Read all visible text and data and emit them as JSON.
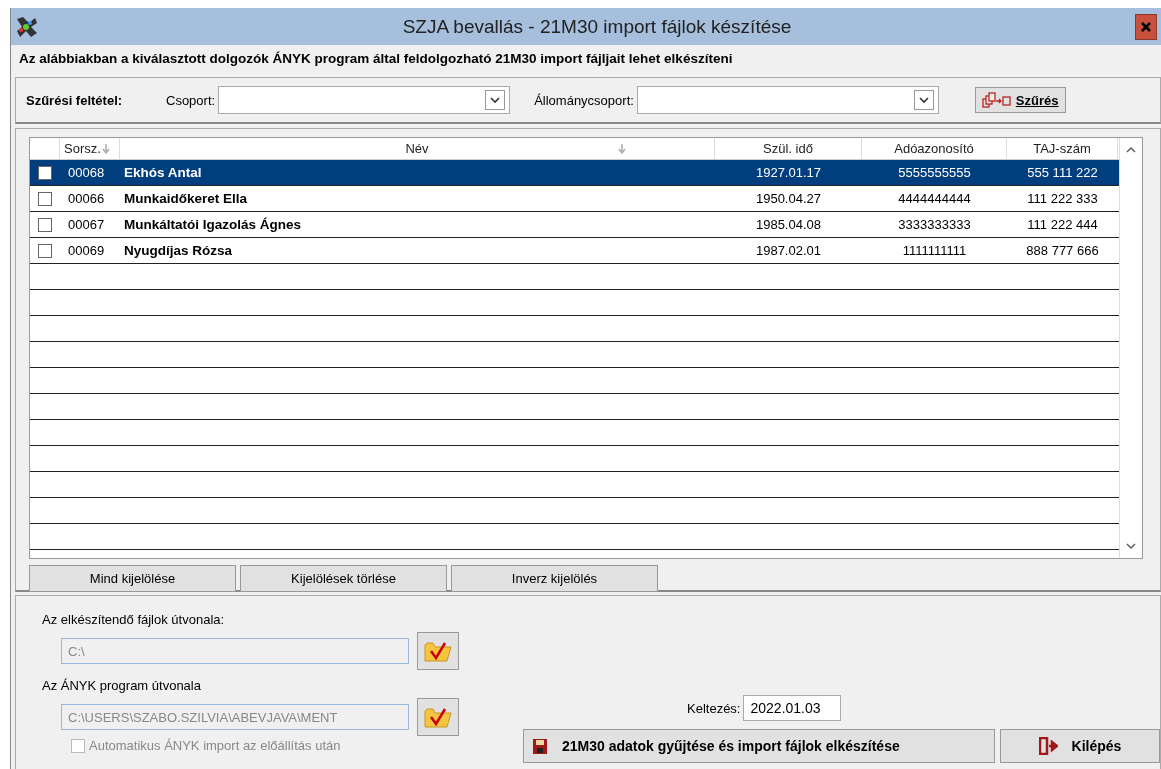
{
  "window": {
    "title": "SZJA bevallás - 21M30 import fájlok készítése"
  },
  "description": "Az alábbiakban a kiválasztott dolgozók ÁNYK program által feldolgozható 21M30 import fájljait lehet elkészíteni",
  "filter": {
    "label": "Szűrési feltétel:",
    "fields": [
      {
        "label": "Csoport:"
      },
      {
        "label": "Állománycsoport:"
      }
    ],
    "button": "Szűrés"
  },
  "table": {
    "columns": [
      {
        "label": "Sorsz.",
        "sorted": true
      },
      {
        "label": "Név",
        "sorted": true
      },
      {
        "label": "Szül. idő",
        "sorted": false
      },
      {
        "label": "Adóazonosító",
        "sorted": false
      },
      {
        "label": "TAJ-szám",
        "sorted": false
      }
    ],
    "rows": [
      {
        "selected": true,
        "checked": false,
        "cells": [
          "00068",
          "Ekhós Antal",
          "1927.01.17",
          "5555555555",
          "555 111 222"
        ]
      },
      {
        "selected": false,
        "checked": false,
        "cells": [
          "00066",
          "Munkaidőkeret Ella",
          "1950.04.27",
          "4444444444",
          "111 222 333"
        ]
      },
      {
        "selected": false,
        "checked": false,
        "cells": [
          "00067",
          "Munkáltatói Igazolás Ágnes",
          "1985.04.08",
          "3333333333",
          "111 222 444"
        ]
      },
      {
        "selected": false,
        "checked": false,
        "cells": [
          "00069",
          "Nyugdíjas Rózsa",
          "1987.02.01",
          "1111111111",
          "888 777 666"
        ]
      }
    ]
  },
  "selection_buttons": [
    "Mind kijelölése",
    "Kijelölések törlése",
    "Inverz kijelölés"
  ],
  "paths": [
    {
      "label": "Az elkészítendő fájlok útvonala:",
      "value": "C:\\",
      "disabled": true
    },
    {
      "label": "Az ÁNYK program útvonala",
      "value": "C:\\USERS\\SZABO.SZILVIA\\ABEVJAVA\\MENT",
      "disabled": true
    }
  ],
  "auto_import": {
    "label": "Automatikus ÁNYK import az előállítás után",
    "checked": false,
    "disabled": true
  },
  "date": {
    "label": "Keltezés:",
    "value": "2022.01.03"
  },
  "actions": [
    {
      "kind": "save",
      "label": "21M30 adatok gyűjtése és import fájlok elkészítése"
    },
    {
      "kind": "exit",
      "label": "Kilépés"
    }
  ]
}
